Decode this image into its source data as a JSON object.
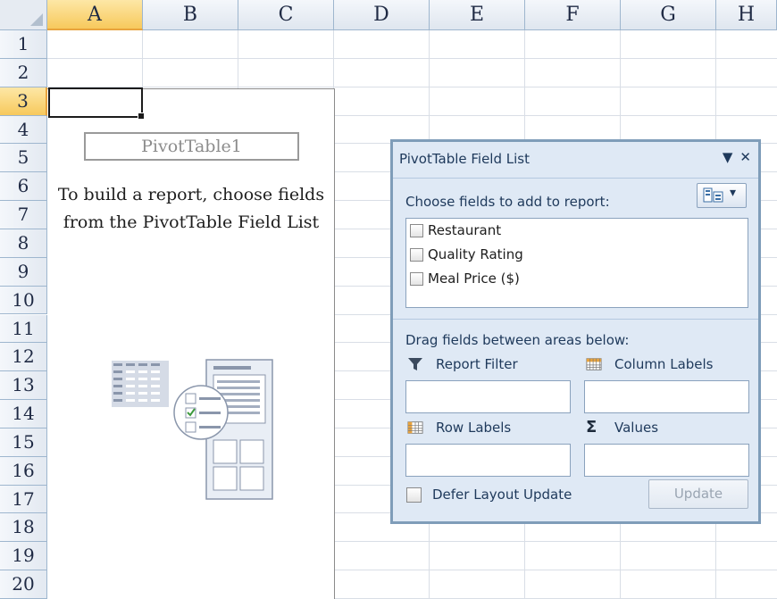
{
  "spreadsheet": {
    "columns": [
      "A",
      "B",
      "C",
      "D",
      "E",
      "F",
      "G",
      "H"
    ],
    "rows": [
      "1",
      "2",
      "3",
      "4",
      "5",
      "6",
      "7",
      "8",
      "9",
      "10",
      "11",
      "12",
      "13",
      "14",
      "15",
      "16",
      "17",
      "18",
      "19",
      "20"
    ],
    "active_column": "A",
    "active_row": "3"
  },
  "pivot_placeholder": {
    "name": "PivotTable1",
    "instruction_line1": "To build a report, choose fields",
    "instruction_line2": "from the PivotTable Field List"
  },
  "field_list": {
    "title": "PivotTable Field List",
    "dropdown_icon": "triangle-down-icon",
    "close_icon": "close-icon",
    "choose_label": "Choose fields to add to report:",
    "fields": [
      {
        "label": "Restaurant",
        "checked": false
      },
      {
        "label": "Quality Rating",
        "checked": false
      },
      {
        "label": "Meal Price ($)",
        "checked": false
      }
    ],
    "drag_label": "Drag fields between areas below:",
    "areas": {
      "report_filter": "Report Filter",
      "column_labels": "Column Labels",
      "row_labels": "Row Labels",
      "values": "Values"
    },
    "defer_label": "Defer Layout Update",
    "defer_checked": false,
    "update_label": "Update"
  },
  "colors": {
    "panel_bg": "#dfe9f5",
    "panel_border": "#7f9db9",
    "header_active": "#f7c95c",
    "header_bg": "#e6ebf2"
  }
}
